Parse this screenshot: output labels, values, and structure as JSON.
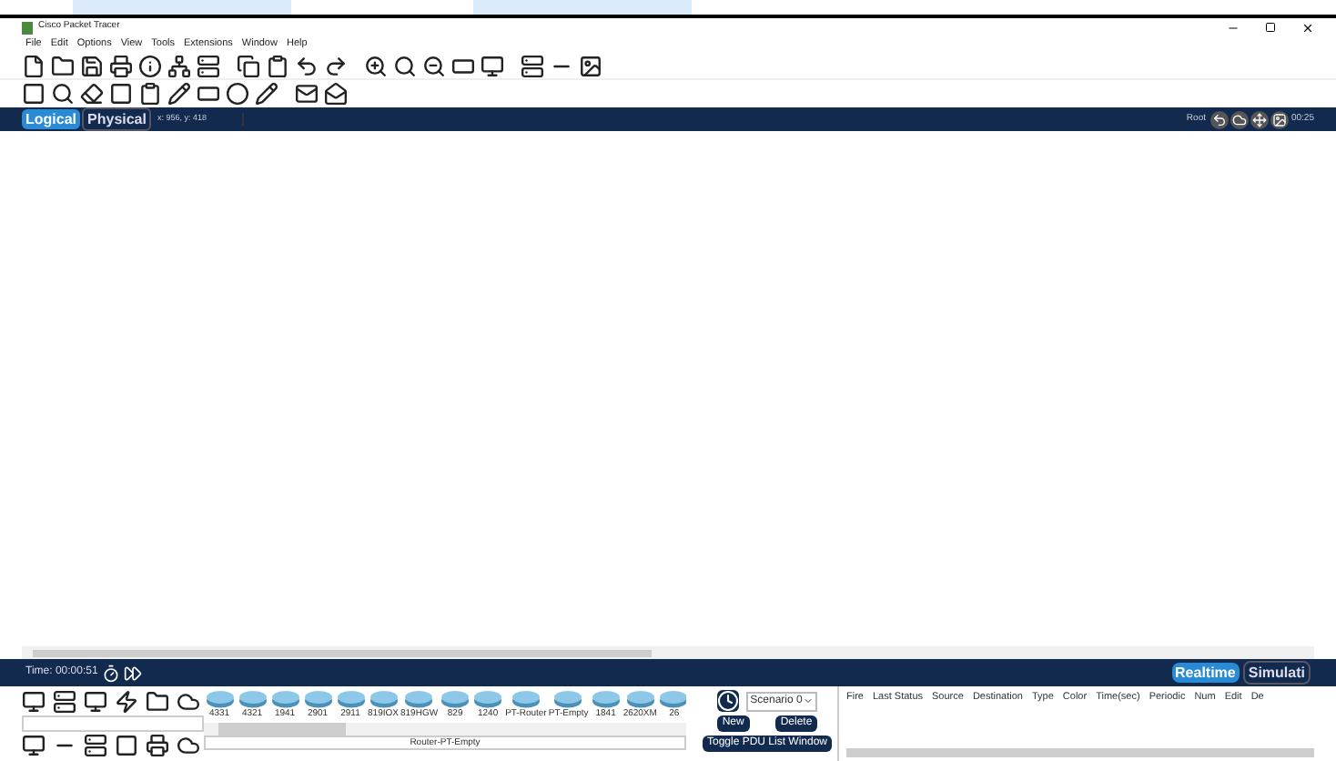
{
  "window": {
    "title": "Cisco Packet Tracer"
  },
  "menu": [
    "File",
    "Edit",
    "Options",
    "View",
    "Tools",
    "Extensions",
    "Window",
    "Help"
  ],
  "workspace_tabs": [
    {
      "label": "Logical",
      "selected": true
    },
    {
      "label": "Physical",
      "selected": false
    }
  ],
  "coordinates": "x: 956, y: 418",
  "navigation": {
    "root": "Root",
    "clock": "00:25"
  },
  "time_bar": {
    "time": "Time: 00:00:51"
  },
  "mode_tabs": [
    {
      "label": "Realtime",
      "selected": true
    },
    {
      "label": "Simulati",
      "selected": false
    }
  ],
  "devices": [
    "4331",
    "4321",
    "1941",
    "2901",
    "2911",
    "819IOX",
    "819HGW",
    "829",
    "1240",
    "PT-Router",
    "PT-Empty",
    "1841",
    "2620XM",
    "26"
  ],
  "device_caption": "Router-PT-Empty",
  "scenario": {
    "value": "Scenario 0",
    "buttons": [
      "New",
      "Delete"
    ],
    "toggle": "Toggle PDU List Window"
  },
  "pdu_table": {
    "columns": [
      "Fire",
      "Last Status",
      "Source",
      "Destination",
      "Type",
      "Color",
      "Time(sec)",
      "Periodic",
      "Num",
      "Edit",
      "De"
    ]
  }
}
